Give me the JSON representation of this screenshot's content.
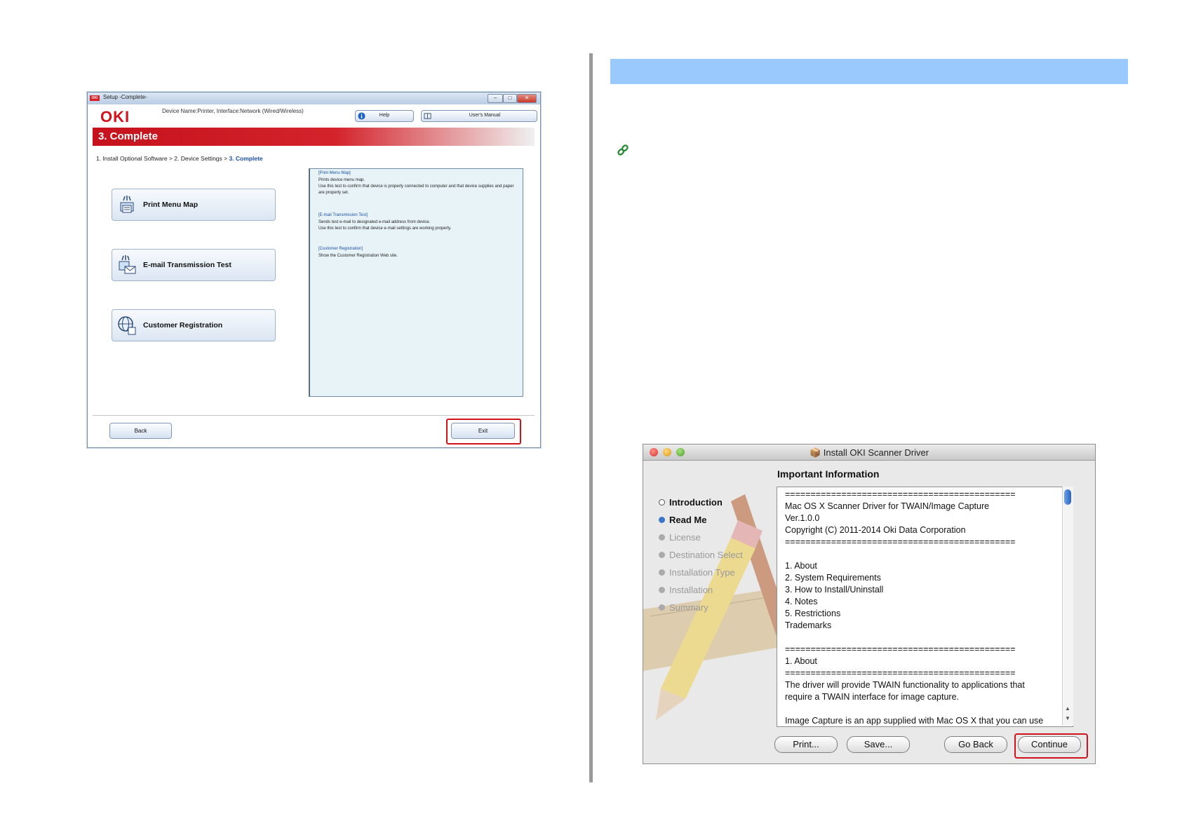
{
  "windows_dialog": {
    "title": "Setup -Complete-",
    "logo": "OKI",
    "device_name": "Device Name:Printer, Interface:Network (Wired/Wireless)",
    "help_label": "Help",
    "manual_label": "User's Manual",
    "step_title": "3. Complete",
    "breadcrumb_prefix": "1. Install Optional Software > 2. Device Settings > ",
    "breadcrumb_current": "3. Complete",
    "actions": [
      {
        "label": "Print Menu Map",
        "icon": "print-menu-icon"
      },
      {
        "label": "E-mail Transmission Test",
        "icon": "email-test-icon"
      },
      {
        "label": "Customer Registration",
        "icon": "globe-registration-icon"
      }
    ],
    "descriptions": [
      {
        "heading": "[Print Menu Map]",
        "lines": [
          "Prints device menu map.",
          "Use this test to confirm that device is properly connected to computer and that device supplies and paper are properly set."
        ]
      },
      {
        "heading": "[E-mail Transmission Test]",
        "lines": [
          "Sends test e-mail to designated e-mail address from device.",
          "Use this test to confirm that device e-mail settings are working properly."
        ]
      },
      {
        "heading": "[Customer Registration]",
        "lines": [
          "Show the Customer Registration Web site."
        ]
      }
    ],
    "back_label": "Back",
    "exit_label": "Exit"
  },
  "mac_installer": {
    "title": "Install OKI Scanner Driver",
    "heading": "Important Information",
    "steps": [
      {
        "label": "Introduction",
        "state": "done"
      },
      {
        "label": "Read Me",
        "state": "current"
      },
      {
        "label": "License",
        "state": "pending"
      },
      {
        "label": "Destination Select",
        "state": "pending"
      },
      {
        "label": "Installation Type",
        "state": "pending"
      },
      {
        "label": "Installation",
        "state": "pending"
      },
      {
        "label": "Summary",
        "state": "pending"
      }
    ],
    "readme_lines": [
      "=============================================",
      "Mac OS X Scanner Driver for TWAIN/Image Capture",
      "Ver.1.0.0",
      "Copyright (C) 2011-2014 Oki Data Corporation",
      "=============================================",
      "",
      "1. About",
      "2. System Requirements",
      "3. How to Install/Uninstall",
      "4. Notes",
      "5. Restrictions",
      "Trademarks",
      "",
      "=============================================",
      "1. About",
      "=============================================",
      "The driver will provide TWAIN functionality to applications that",
      "require a TWAIN interface for image capture.",
      "",
      "Image Capture is an app supplied with Mac OS X that you can use"
    ],
    "print_label": "Print...",
    "save_label": "Save...",
    "goback_label": "Go Back",
    "continue_label": "Continue"
  },
  "colors": {
    "oki_red": "#d3121c",
    "highlight_red": "#d0121b",
    "header_blue": "#99c9fd"
  }
}
